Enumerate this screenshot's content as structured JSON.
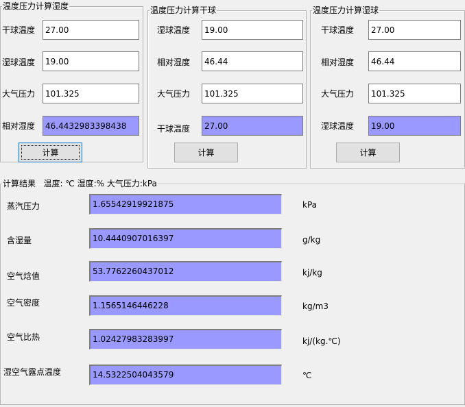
{
  "panel_humidity": {
    "title": "温度压力计算湿度",
    "dry_bulb_label": "干球温度",
    "dry_bulb_value": "27.00",
    "wet_bulb_label": "湿球温度",
    "wet_bulb_value": "19.00",
    "pressure_label": "大气压力",
    "pressure_value": "101.325",
    "rh_label": "相对湿度",
    "rh_value": "46.4432983398438",
    "calc_label": "计算"
  },
  "panel_dry_bulb": {
    "title": "温度压力计算干球",
    "wet_bulb_label": "湿球温度",
    "wet_bulb_value": "19.00",
    "rh_label": "相对湿度",
    "rh_value": "46.44",
    "pressure_label": "大气压力",
    "pressure_value": "101.325",
    "dry_bulb_label": "干球温度",
    "dry_bulb_value": "27.00",
    "calc_label": "计算"
  },
  "panel_wet_bulb": {
    "title": "温度压力计算湿球",
    "dry_bulb_label": "干球温度",
    "dry_bulb_value": "27.00",
    "rh_label": "相对湿度",
    "rh_value": "46.44",
    "pressure_label": "大气压力",
    "pressure_value": "101.325",
    "wet_bulb_label": "湿球温度",
    "wet_bulb_value": "19.00",
    "calc_label": "计算"
  },
  "results": {
    "title": "计算结果   温度: ℃ 湿度:% 大气压力:kPa",
    "rows": [
      {
        "label": "蒸汽压力",
        "value": "1.65542919921875",
        "unit": "kPa"
      },
      {
        "label": "含湿量",
        "value": "10.4440907016397",
        "unit": "g/kg"
      },
      {
        "label": "空气焓值",
        "value": "53.7762260437012",
        "unit": "kj/kg"
      },
      {
        "label": "空气密度",
        "value": "1.1565146446228",
        "unit": "kg/m3"
      },
      {
        "label": "空气比热",
        "value": "1.02427983283997",
        "unit": "kj/(kg.℃)"
      },
      {
        "label": "湿空气露点温度",
        "value": "14.5322504043579",
        "unit": "℃"
      }
    ]
  },
  "colors": {
    "readonly_field": "#9999ff",
    "window_bg": "#f0f0f0",
    "button_bg": "#e1e1e1"
  }
}
